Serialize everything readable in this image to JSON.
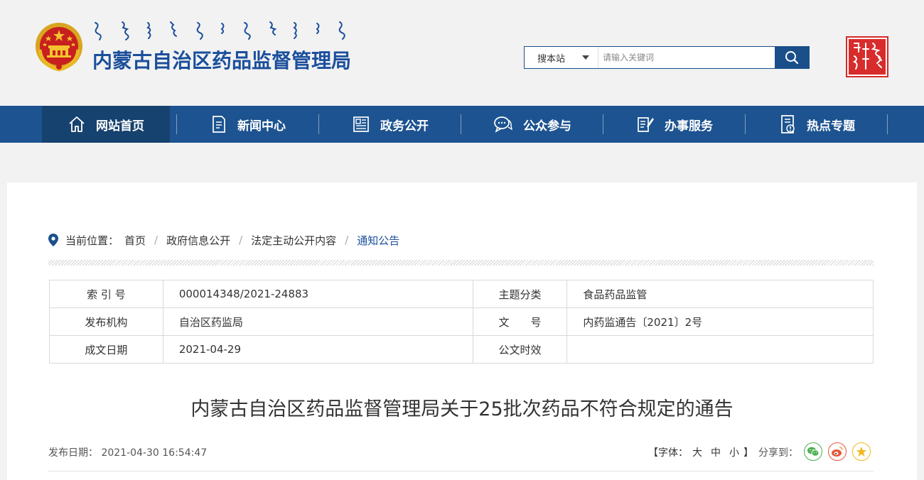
{
  "header": {
    "site_title": "内蒙古自治区药品监督管理局",
    "search": {
      "scope_label": "搜本站",
      "placeholder": "请输入关键词"
    }
  },
  "nav": {
    "items": [
      {
        "label": "网站首页",
        "icon": "home-icon"
      },
      {
        "label": "新闻中心",
        "icon": "document-icon"
      },
      {
        "label": "政务公开",
        "icon": "newspaper-icon"
      },
      {
        "label": "公众参与",
        "icon": "chat-icon"
      },
      {
        "label": "办事服务",
        "icon": "edit-list-icon"
      },
      {
        "label": "热点专题",
        "icon": "notice-icon"
      }
    ],
    "active_index": 0
  },
  "breadcrumb": {
    "prefix": "当前位置：",
    "items": [
      "首页",
      "政府信息公开",
      "法定主动公开内容",
      "通知公告"
    ],
    "separator": "/"
  },
  "meta_table": {
    "rows": [
      {
        "k1": "索 引 号",
        "v1": "000014348/2021-24883",
        "k2": "主题分类",
        "v2": "食品药品监管"
      },
      {
        "k1": "发布机构",
        "v1": "自治区药监局",
        "k2": "文　　号",
        "v2": "内药监通告〔2021〕2号"
      },
      {
        "k1": "成文日期",
        "v1": "2021-04-29",
        "k2": "公文时效",
        "v2": ""
      }
    ]
  },
  "article": {
    "title": "内蒙古自治区药品监督管理局关于25批次药品不符合规定的通告",
    "pubdate_label": "发布日期：",
    "pubdate": "2021-04-30 16:54:47",
    "font_label_open": "【字体：",
    "font_large": "大",
    "font_medium": "中",
    "font_small": "小",
    "font_label_close": "】",
    "share_label": "分享到："
  },
  "colors": {
    "brand_blue": "#1d5390",
    "nav_active": "#16426f",
    "title_blue": "#1b4f9c",
    "wechat_green": "#4caf50",
    "weibo_orange": "#e8573a",
    "qzone_yellow": "#f2b81d"
  }
}
